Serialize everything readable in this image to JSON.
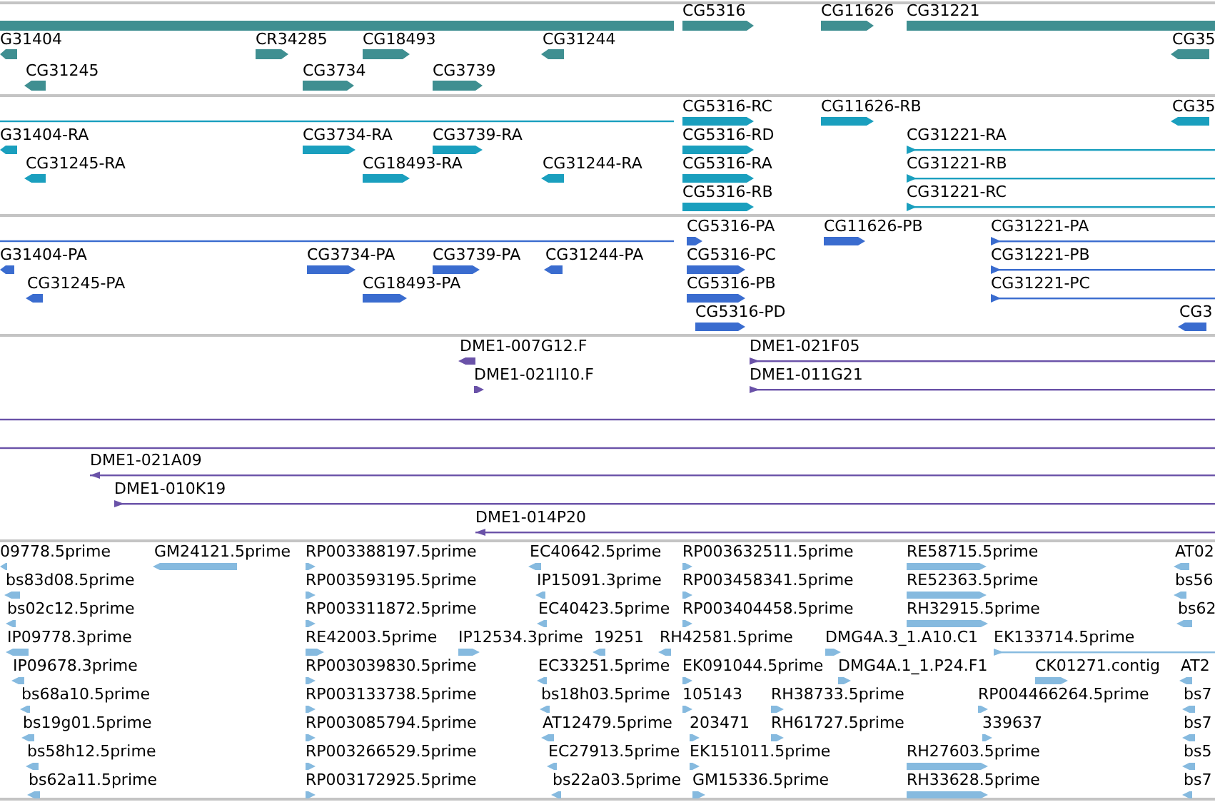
{
  "tracks": [
    {
      "kind": "genes",
      "features": [
        {
          "label": "CG5316",
          "reverse": false
        },
        {
          "label": "CG11626",
          "reverse": false
        },
        {
          "label": "CG31221",
          "reverse": false
        },
        {
          "label": "G31404",
          "reverse": true
        },
        {
          "label": "CR34285",
          "reverse": false
        },
        {
          "label": "CG18493",
          "reverse": false
        },
        {
          "label": "CG31244",
          "reverse": true
        },
        {
          "label": "CG35",
          "reverse": true
        },
        {
          "label": "CG31245",
          "reverse": true
        },
        {
          "label": "CG3734",
          "reverse": false
        },
        {
          "label": "CG3739",
          "reverse": false
        }
      ]
    },
    {
      "kind": "transcripts",
      "features": [
        {
          "label": "CG5316-RC",
          "reverse": false
        },
        {
          "label": "CG11626-RB",
          "reverse": false
        },
        {
          "label": "CG35",
          "reverse": true
        },
        {
          "label": "G31404-RA",
          "reverse": true
        },
        {
          "label": "CG3734-RA",
          "reverse": false
        },
        {
          "label": "CG3739-RA",
          "reverse": false
        },
        {
          "label": "CG5316-RD",
          "reverse": false
        },
        {
          "label": "CG31221-RA",
          "reverse": false
        },
        {
          "label": "CG31245-RA",
          "reverse": true
        },
        {
          "label": "CG18493-RA",
          "reverse": false
        },
        {
          "label": "CG31244-RA",
          "reverse": true
        },
        {
          "label": "CG5316-RA",
          "reverse": false
        },
        {
          "label": "CG31221-RB",
          "reverse": false
        },
        {
          "label": "CG5316-RB",
          "reverse": false
        },
        {
          "label": "CG31221-RC",
          "reverse": false
        }
      ]
    },
    {
      "kind": "proteins",
      "features": [
        {
          "label": "CG5316-PA",
          "reverse": false
        },
        {
          "label": "CG11626-PB",
          "reverse": false
        },
        {
          "label": "CG31221-PA",
          "reverse": false
        },
        {
          "label": "G31404-PA",
          "reverse": true
        },
        {
          "label": "CG3734-PA",
          "reverse": false
        },
        {
          "label": "CG3739-PA",
          "reverse": false
        },
        {
          "label": "CG31244-PA",
          "reverse": true
        },
        {
          "label": "CG5316-PC",
          "reverse": false
        },
        {
          "label": "CG31221-PB",
          "reverse": false
        },
        {
          "label": "CG31245-PA",
          "reverse": true
        },
        {
          "label": "CG18493-PA",
          "reverse": false
        },
        {
          "label": "CG5316-PB",
          "reverse": false
        },
        {
          "label": "CG31221-PC",
          "reverse": false
        },
        {
          "label": "CG5316-PD",
          "reverse": false
        },
        {
          "label": "CG3",
          "reverse": true
        }
      ]
    },
    {
      "kind": "clones",
      "features": [
        {
          "label": "DME1-007G12.F",
          "reverse": true
        },
        {
          "label": "DME1-021I10.F",
          "reverse": false
        },
        {
          "label": "DME1-021F05",
          "reverse": false
        },
        {
          "label": "DME1-011G21",
          "reverse": false
        },
        {
          "label": "DME1-021A09",
          "reverse": true
        },
        {
          "label": "DME1-010K19",
          "reverse": false
        },
        {
          "label": "DME1-014P20",
          "reverse": true
        }
      ]
    },
    {
      "kind": "ests",
      "features": [
        {
          "label": "09778.5prime",
          "reverse": true
        },
        {
          "label": "GM24121.5prime",
          "reverse": true
        },
        {
          "label": "RP003388197.5prime",
          "reverse": false
        },
        {
          "label": "EC40642.5prime",
          "reverse": true
        },
        {
          "label": "RP003632511.5prime",
          "reverse": false
        },
        {
          "label": "RE58715.5prime",
          "reverse": false
        },
        {
          "label": "AT02",
          "reverse": true
        },
        {
          "label": "bs83d08.5prime",
          "reverse": true
        },
        {
          "label": "RP003593195.5prime",
          "reverse": false
        },
        {
          "label": "IP15091.3prime",
          "reverse": true
        },
        {
          "label": "RP003458341.5prime",
          "reverse": false
        },
        {
          "label": "RE52363.5prime",
          "reverse": false
        },
        {
          "label": "bs56",
          "reverse": true
        },
        {
          "label": "bs02c12.5prime",
          "reverse": true
        },
        {
          "label": "RP003311872.5prime",
          "reverse": false
        },
        {
          "label": "EC40423.5prime",
          "reverse": true
        },
        {
          "label": "RP003404458.5prime",
          "reverse": false
        },
        {
          "label": "RH32915.5prime",
          "reverse": false
        },
        {
          "label": "bs62",
          "reverse": true
        },
        {
          "label": "IP09778.3prime",
          "reverse": true
        },
        {
          "label": "RE42003.5prime",
          "reverse": false
        },
        {
          "label": "IP12534.3prime",
          "reverse": false
        },
        {
          "label": "19251",
          "reverse": true
        },
        {
          "label": "RH42581.5prime",
          "reverse": true
        },
        {
          "label": "DMG4A.3_1.A10.C1",
          "reverse": false
        },
        {
          "label": "EK133714.5prime",
          "reverse": false
        },
        {
          "label": "IP09678.3prime",
          "reverse": true
        },
        {
          "label": "RP003039830.5prime",
          "reverse": false
        },
        {
          "label": "EC33251.5prime",
          "reverse": true
        },
        {
          "label": "EK091044.5prime",
          "reverse": false
        },
        {
          "label": "DMG4A.1_1.P24.F1",
          "reverse": false
        },
        {
          "label": "CK01271.contig",
          "reverse": false
        },
        {
          "label": "AT2",
          "reverse": true
        },
        {
          "label": "bs68a10.5prime",
          "reverse": true
        },
        {
          "label": "RP003133738.5prime",
          "reverse": false
        },
        {
          "label": "bs18h03.5prime",
          "reverse": true
        },
        {
          "label": "105143",
          "reverse": false
        },
        {
          "label": "RH38733.5prime",
          "reverse": false
        },
        {
          "label": "RP004466264.5prime",
          "reverse": false
        },
        {
          "label": "bs7",
          "reverse": true
        },
        {
          "label": "bs19g01.5prime",
          "reverse": true
        },
        {
          "label": "RP003085794.5prime",
          "reverse": false
        },
        {
          "label": "AT12479.5prime",
          "reverse": true
        },
        {
          "label": "203471",
          "reverse": false
        },
        {
          "label": "RH61727.5prime",
          "reverse": false
        },
        {
          "label": "339637",
          "reverse": false
        },
        {
          "label": "bs7",
          "reverse": true
        },
        {
          "label": "bs58h12.5prime",
          "reverse": true
        },
        {
          "label": "RP003266529.5prime",
          "reverse": false
        },
        {
          "label": "EC27913.5prime",
          "reverse": true
        },
        {
          "label": "EK151011.5prime",
          "reverse": false
        },
        {
          "label": "RH27603.5prime",
          "reverse": false
        },
        {
          "label": "bs5",
          "reverse": true
        },
        {
          "label": "bs62a11.5prime",
          "reverse": true
        },
        {
          "label": "RP003172925.5prime",
          "reverse": false
        },
        {
          "label": "bs22a03.5prime",
          "reverse": true
        },
        {
          "label": "GM15336.5prime",
          "reverse": false
        },
        {
          "label": "RH33628.5prime",
          "reverse": false
        },
        {
          "label": "bs7",
          "reverse": true
        }
      ]
    }
  ]
}
